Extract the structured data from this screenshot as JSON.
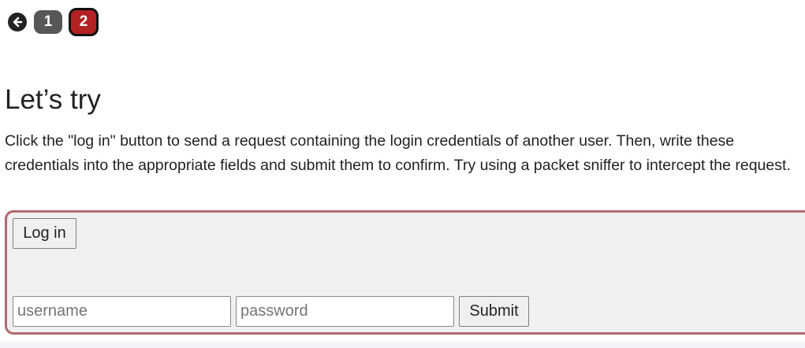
{
  "nav": {
    "back_icon": "arrow-left-circle-icon",
    "steps": [
      {
        "label": "1",
        "color": "#575757",
        "active": false
      },
      {
        "label": "2",
        "color": "#b22222",
        "active": true
      }
    ]
  },
  "main": {
    "title": "Let’s try",
    "description": "Click the \"log in\" button to send a request containing the login credentials of another user. Then, write these credentials into the appropriate fields and submit them to confirm. Try using a packet sniffer to intercept the request."
  },
  "form": {
    "login_label": "Log in",
    "username_placeholder": "username",
    "username_value": "",
    "password_placeholder": "password",
    "password_value": "",
    "submit_label": "Submit"
  },
  "colors": {
    "panel_border": "#b06a6e",
    "panel_background": "#f0f0f0",
    "active_step": "#b22222",
    "inactive_step": "#575757"
  }
}
